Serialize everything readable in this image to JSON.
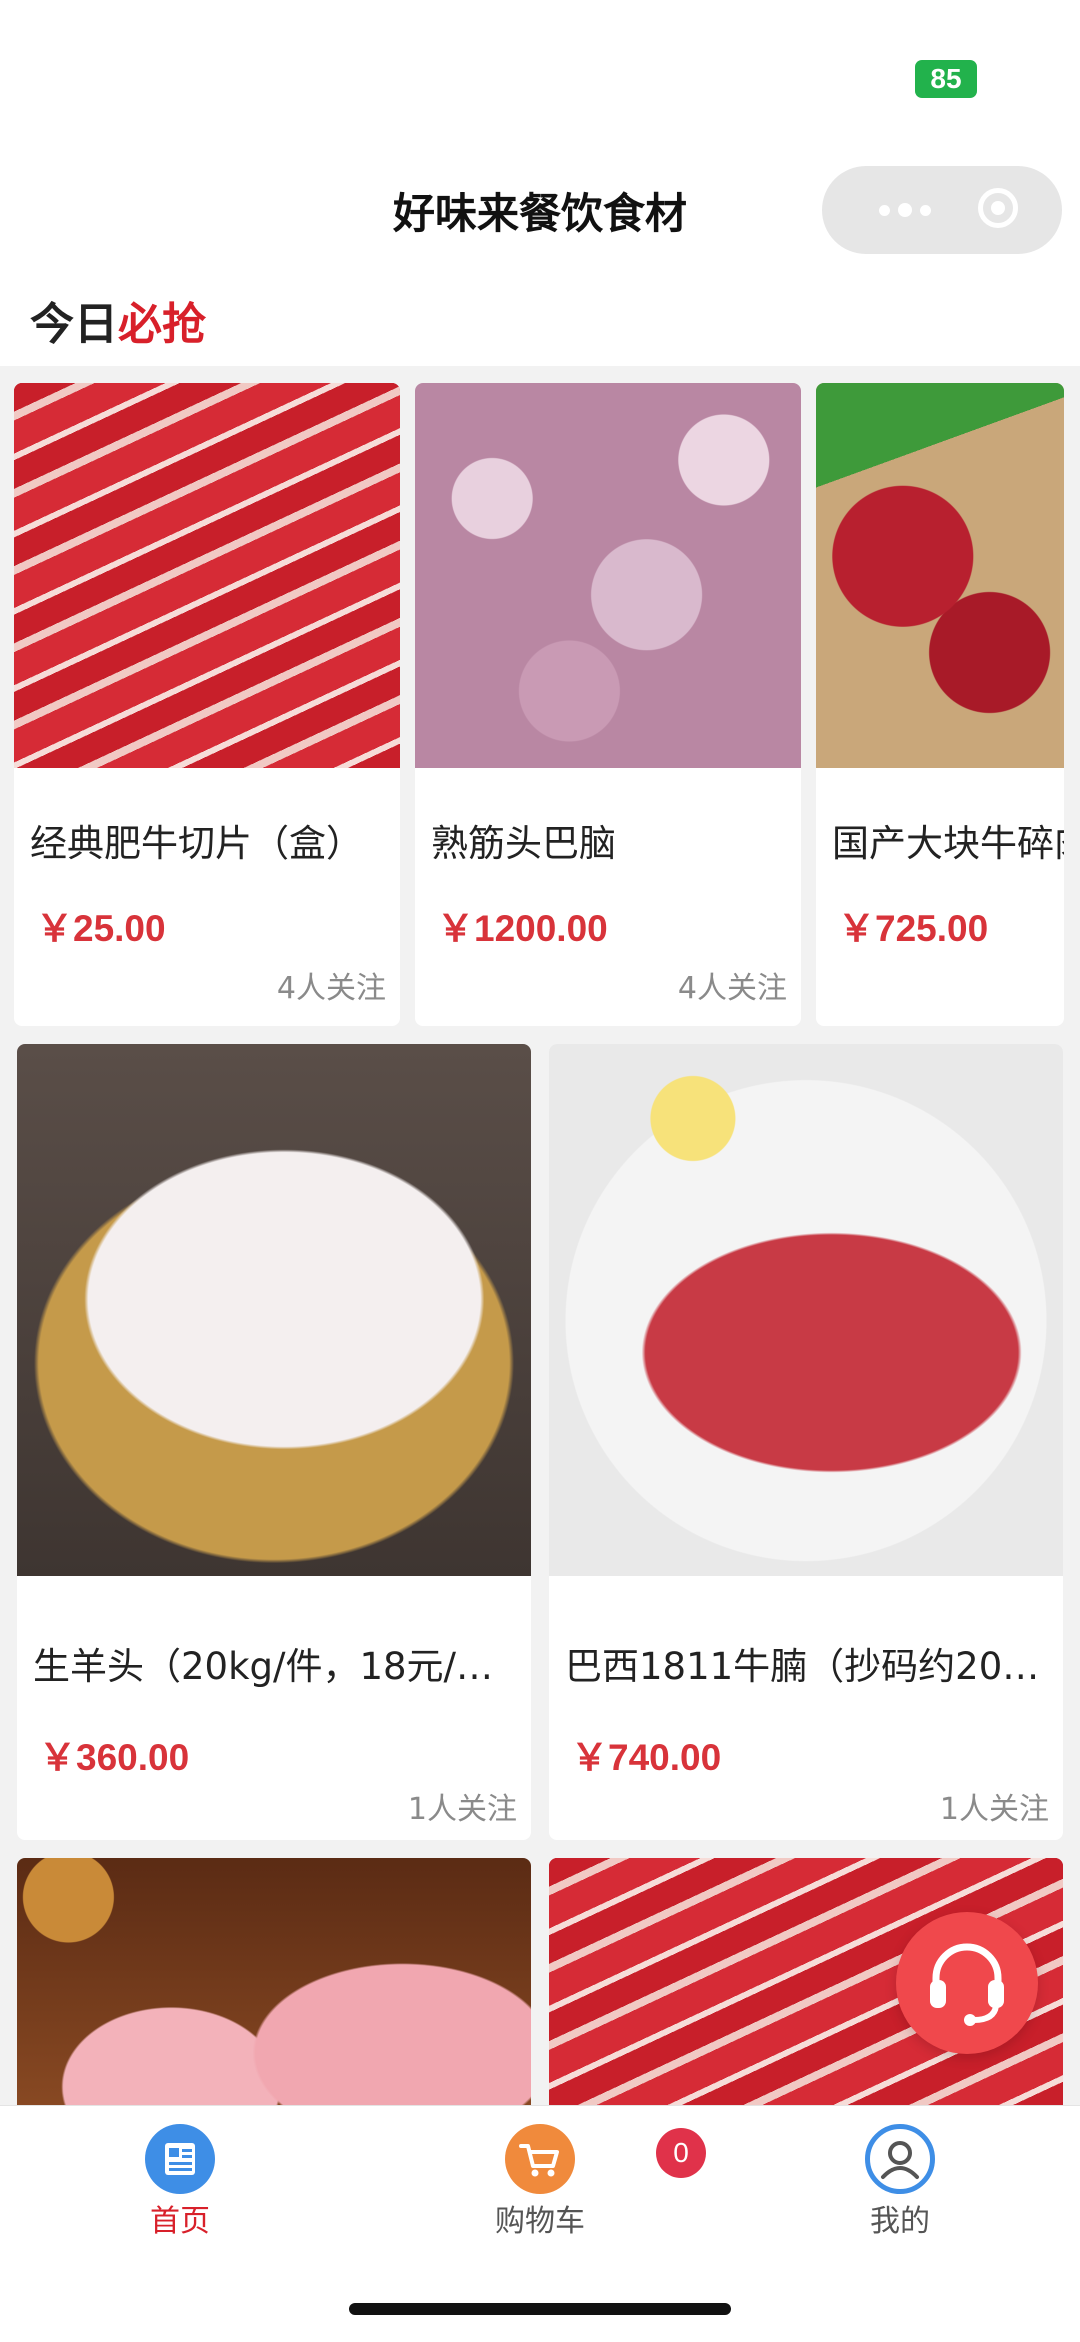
{
  "status_bar": {
    "battery": "85"
  },
  "header": {
    "title": "好味来餐饮食材"
  },
  "section": {
    "title_plain": "今日",
    "title_accent": "必抢"
  },
  "products_row1": [
    {
      "name": "经典肥牛切片（盒）",
      "price": "￥25.00",
      "followers": "4人关注",
      "image": "beef-rolls"
    },
    {
      "name": "熟筋头巴脑",
      "price": "￥1200.00",
      "followers": "4人关注",
      "image": "tendon"
    },
    {
      "name": "国产大块牛碎肉",
      "price": "￥725.00",
      "followers": "",
      "image": "beef-chunks"
    }
  ],
  "products_row2": [
    {
      "name": "生羊头（20kg/件，18元/…",
      "price": "￥360.00",
      "followers": "1人关注",
      "image": "sheep-head"
    },
    {
      "name": "巴西1811牛腩（抄码约20…",
      "price": "￥740.00",
      "followers": "1人关注",
      "image": "brisket"
    }
  ],
  "products_row3": [
    {
      "image": "ham"
    },
    {
      "image": "beef-rolls"
    }
  ],
  "tabbar": {
    "home": "首页",
    "cart": "购物车",
    "cart_count": "0",
    "mine": "我的"
  },
  "colors": {
    "accent": "#d8202a",
    "price": "#d8333a",
    "home_icon": "#3e8ee6",
    "cart_icon": "#f08a3c",
    "service": "#f0484c"
  }
}
